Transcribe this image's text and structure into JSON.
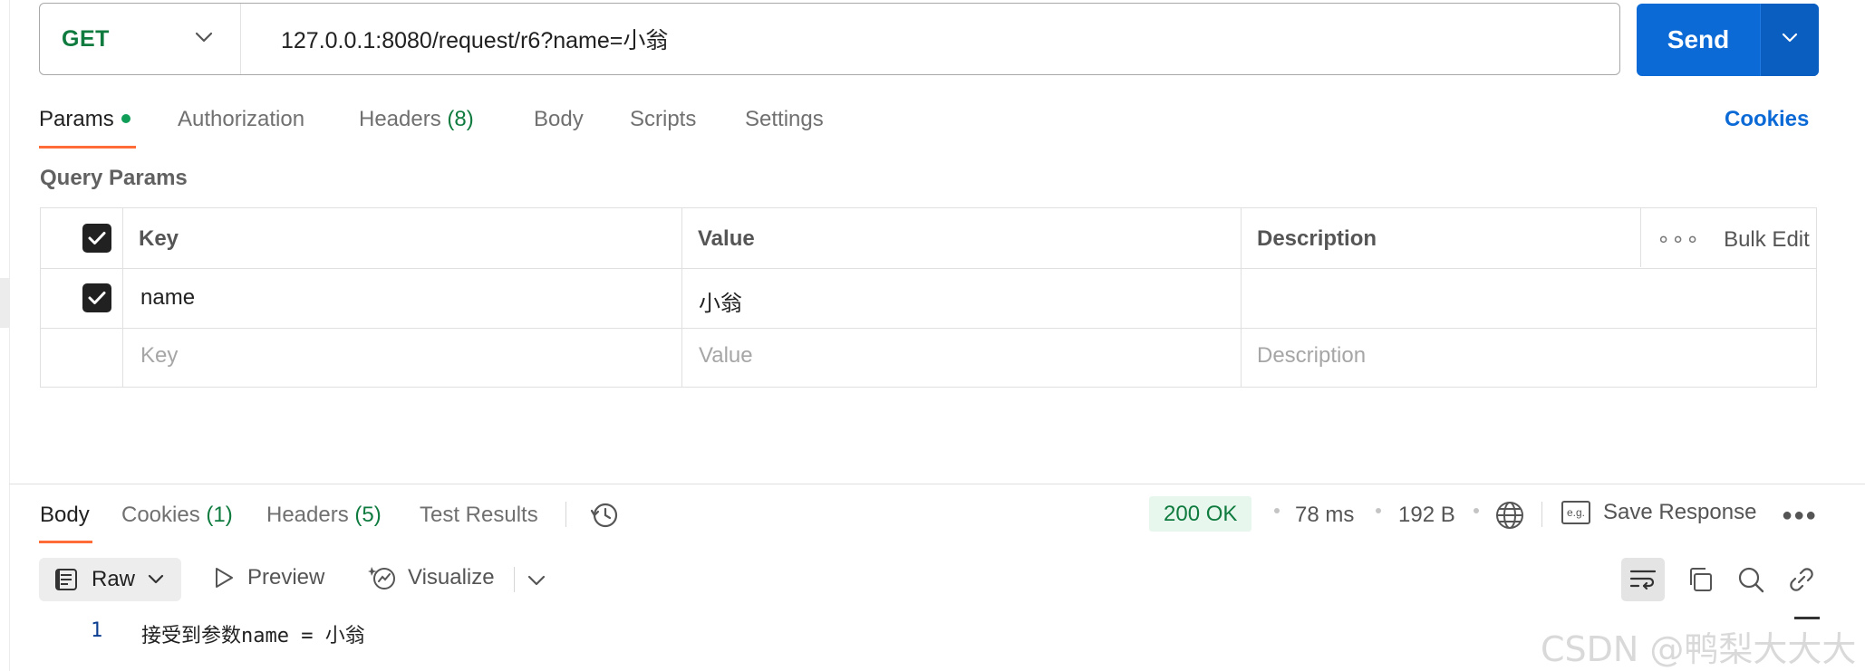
{
  "request": {
    "method": "GET",
    "url": "127.0.0.1:8080/request/r6?name=小翁",
    "send_label": "Send"
  },
  "request_tabs": [
    {
      "label": "Params",
      "active": true
    },
    {
      "label": "Authorization"
    },
    {
      "label": "Headers",
      "count": "(8)"
    },
    {
      "label": "Body"
    },
    {
      "label": "Scripts"
    },
    {
      "label": "Settings"
    }
  ],
  "cookies_link": "Cookies",
  "query_params": {
    "title": "Query Params",
    "headers": {
      "key": "Key",
      "value": "Value",
      "description": "Description",
      "bulk_edit": "Bulk Edit"
    },
    "rows": [
      {
        "key": "name",
        "value": "小翁",
        "description": "",
        "checked": true
      }
    ],
    "placeholders": {
      "key": "Key",
      "value": "Value",
      "description": "Description"
    }
  },
  "response": {
    "tabs": [
      {
        "label": "Body",
        "active": true
      },
      {
        "label": "Cookies",
        "count": "(1)"
      },
      {
        "label": "Headers",
        "count": "(5)"
      },
      {
        "label": "Test Results"
      }
    ],
    "status": "200 OK",
    "time": "78 ms",
    "size": "192 B",
    "save_response": "Save Response",
    "format": "Raw",
    "preview": "Preview",
    "visualize": "Visualize",
    "lines": [
      {
        "no": "1",
        "text": "接受到参数name = 小翁"
      }
    ]
  },
  "watermark": "CSDN @鸭梨大大大",
  "colors": {
    "accent": "#0b6ad6",
    "tab_indicator": "#ff6c37",
    "success": "#0f7b3f"
  }
}
